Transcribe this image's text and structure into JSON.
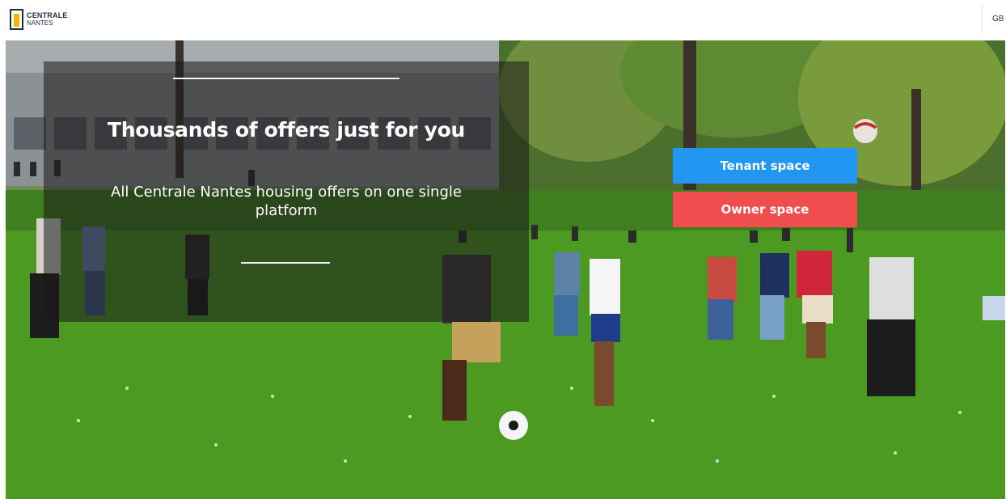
{
  "header": {
    "logo": {
      "line1": "CENTRALE",
      "line2": "NANTES"
    },
    "language": "GB"
  },
  "hero": {
    "title": "Thousands of offers just for you",
    "subtitle": "All Centrale Nantes housing offers on one single platform"
  },
  "actions": {
    "tenant_label": "Tenant space",
    "owner_label": "Owner space"
  },
  "colors": {
    "tenant": "#2196f3",
    "owner": "#f04e4e",
    "logo_accent": "#f4b400"
  }
}
